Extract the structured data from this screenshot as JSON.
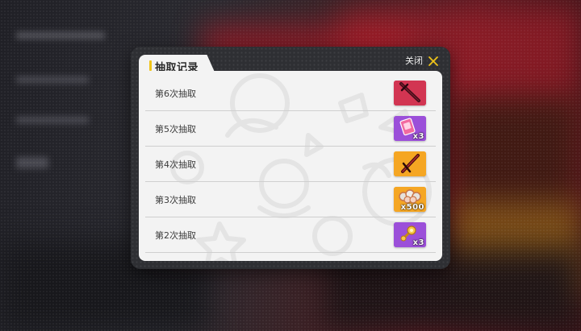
{
  "dialog": {
    "title": "抽取记录",
    "close_label": "关闭"
  },
  "records": [
    {
      "label": "第6次抽取",
      "item_icon": "crimson-blade-icon",
      "rarity_color": "#d23552",
      "quantity": ""
    },
    {
      "label": "第5次抽取",
      "item_icon": "pink-card-icon",
      "rarity_color": "#9b4fd9",
      "quantity": "x3"
    },
    {
      "label": "第4次抽取",
      "item_icon": "dark-blade-icon",
      "rarity_color": "#f5a623",
      "quantity": ""
    },
    {
      "label": "第3次抽取",
      "item_icon": "ore-pile-icon",
      "rarity_color": "#f5a623",
      "quantity": "x500"
    },
    {
      "label": "第2次抽取",
      "item_icon": "golden-gear-icon",
      "rarity_color": "#9b4fd9",
      "quantity": "x3"
    }
  ],
  "colors": {
    "accent": "#f0c419",
    "panel": "#f3f3f3",
    "frame": "#2e2f33"
  }
}
